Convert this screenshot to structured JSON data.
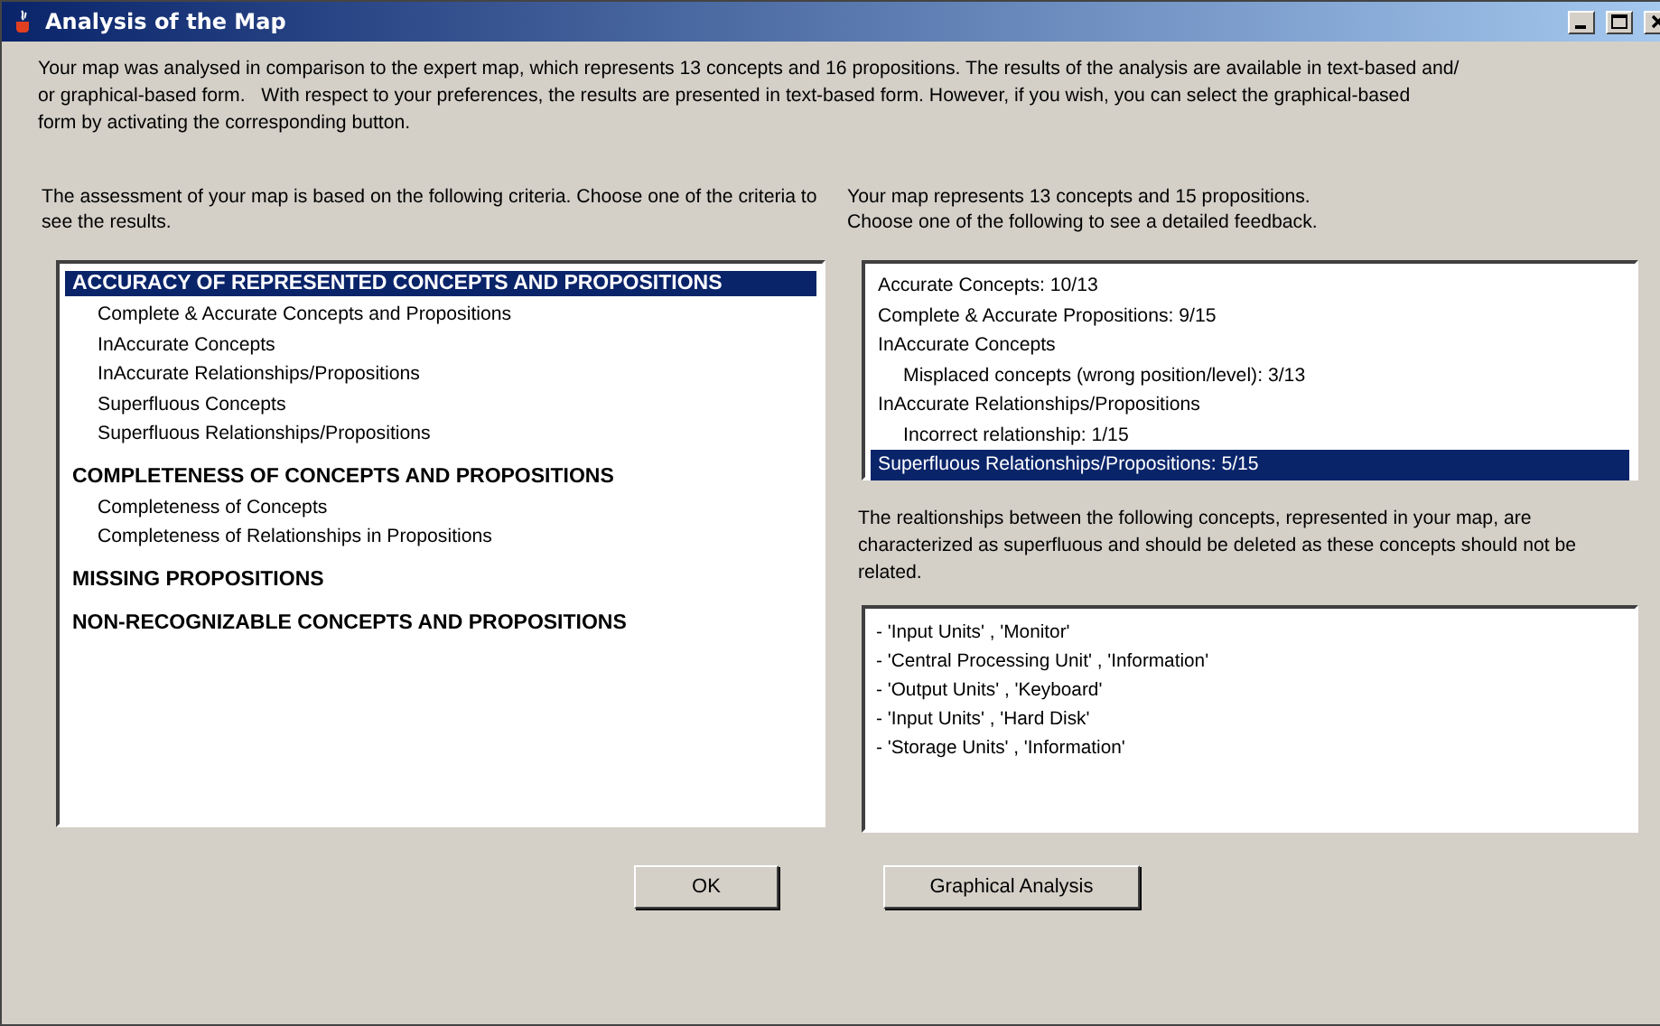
{
  "window": {
    "title": "Analysis of the Map"
  },
  "intro": [
    "Your map was analysed in comparison to the expert map, which represents 13 concepts and 16 propositions. The results of the analysis are available in text-based and/",
    "or graphical-based form.   With respect to your preferences, the results are presented in text-based form. However, if you wish, you can select the graphical-based",
    "form by activating the corresponding button."
  ],
  "criteria": {
    "caption": "The assessment of your map is based on the following criteria. Choose one of the criteria to see the results.",
    "items": [
      {
        "label": "ACCURACY OF REPRESENTED CONCEPTS AND PROPOSITIONS",
        "selected": true,
        "children": [
          {
            "label": "Complete & Accurate Concepts and Propositions",
            "selected": false
          },
          {
            "label": "InAccurate Concepts",
            "selected": false
          },
          {
            "label": "InAccurate Relationships/Propositions",
            "selected": false
          },
          {
            "label": "Superfluous Concepts",
            "selected": false
          },
          {
            "label": "Superfluous Relationships/Propositions",
            "selected": false
          }
        ]
      },
      {
        "label": "COMPLETENESS OF CONCEPTS AND PROPOSITIONS",
        "selected": false,
        "children": [
          {
            "label": "Completeness of Concepts",
            "selected": false
          },
          {
            "label": "Completeness of Relationships in Propositions",
            "selected": false
          }
        ]
      },
      {
        "label": "MISSING PROPOSITIONS",
        "selected": false
      },
      {
        "label": "NON-RECOGNIZABLE CONCEPTS AND PROPOSITIONS",
        "selected": false
      }
    ]
  },
  "feedback": {
    "caption": "Your map represents 13 concepts and 15 propositions.\nChoose one of the following to see a detailed feedback.",
    "items": [
      {
        "label": "Accurate Concepts: 10/13",
        "selected": false
      },
      {
        "label": "Complete & Accurate Propositions: 9/15",
        "selected": false
      },
      {
        "label": "InAccurate Concepts",
        "selected": false,
        "children": [
          {
            "label": "Misplaced concepts (wrong position/level): 3/13",
            "selected": false
          }
        ]
      },
      {
        "label": "InAccurate Relationships/Propositions",
        "selected": false,
        "children": [
          {
            "label": "Incorrect relationship: 1/15",
            "selected": false
          }
        ]
      },
      {
        "label": "Superfluous Relationships/Propositions: 5/15",
        "selected": true
      }
    ]
  },
  "details": {
    "caption": "The realtionships between the following concepts, represented in your map, are characterized as superfluous and should be deleted as these concepts should not be related.",
    "lines": [
      "- 'Input Units' , 'Monitor'",
      "- 'Central Processing Unit' , 'Information'",
      "- 'Output Units' , 'Keyboard'",
      "- 'Input Units' , 'Hard Disk'",
      "- 'Storage Units' , 'Information'"
    ]
  },
  "buttons": [
    "OK",
    "Graphical Analysis"
  ]
}
